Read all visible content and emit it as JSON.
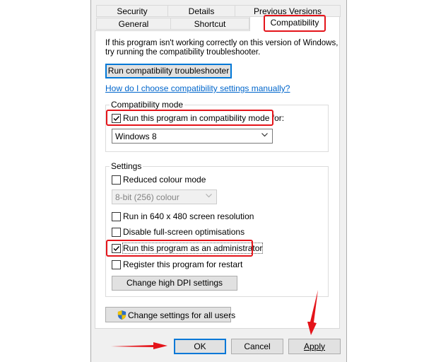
{
  "tabs": {
    "row1": [
      "Security",
      "Details",
      "Previous Versions"
    ],
    "row2": [
      "General",
      "Shortcut",
      "Compatibility"
    ],
    "active": "Compatibility"
  },
  "intro": {
    "line1": "If this program isn't working correctly on this version of Windows,",
    "line2": "try running the compatibility troubleshooter."
  },
  "troubleshoot_button": "Run compatibility troubleshooter",
  "help_link": "How do I choose compatibility settings manually?",
  "compat_mode": {
    "group_label": "Compatibility mode",
    "checkbox_label": "Run this program in compatibility mode for:",
    "checked": true,
    "selected_os": "Windows 8"
  },
  "settings": {
    "group_label": "Settings",
    "reduced_colour": {
      "label": "Reduced colour mode",
      "checked": false
    },
    "colour_select": "8-bit (256) colour",
    "res640": {
      "label": "Run in 640 x 480 screen resolution",
      "checked": false
    },
    "fullscreen": {
      "label": "Disable full-screen optimisations",
      "checked": false
    },
    "admin": {
      "label": "Run this program as an administrator",
      "checked": true
    },
    "restart": {
      "label": "Register this program for restart",
      "checked": false
    },
    "dpi_button": "Change high DPI settings"
  },
  "all_users_button": "Change settings for all users",
  "footer": {
    "ok": "OK",
    "cancel": "Cancel",
    "apply": "Apply"
  },
  "colors": {
    "highlight": "#e4141a",
    "link": "#0066cc",
    "focus": "#0078d7"
  },
  "icons": [
    "uac-shield-icon",
    "checkmark-icon",
    "chevron-down-icon",
    "arrow-right-icon",
    "arrow-down-icon"
  ]
}
